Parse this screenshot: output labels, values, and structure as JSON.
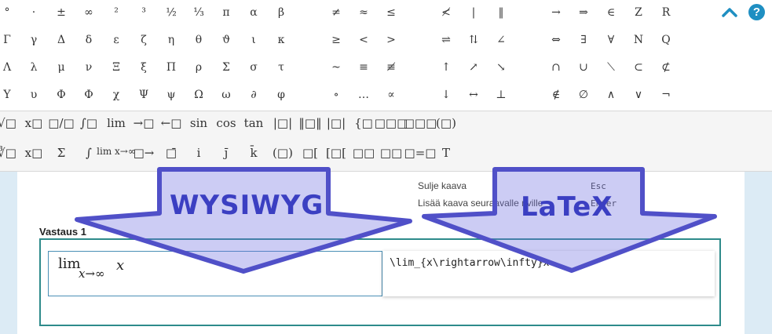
{
  "symbols": {
    "row1": [
      "°",
      "·",
      "±",
      "∞",
      "²",
      "³",
      "½",
      "⅓",
      "π",
      "α",
      "β",
      "≠",
      "≈",
      "≤",
      "≮",
      "|",
      "‖",
      "→",
      "⇒",
      "∈",
      "Z",
      "R"
    ],
    "row2": [
      "Γ",
      "γ",
      "Δ",
      "δ",
      "ε",
      "ζ",
      "η",
      "θ",
      "ϑ",
      "ι",
      "κ",
      "≥",
      "<",
      ">",
      "⇌",
      "⇅",
      "∠",
      "⇔",
      "∃",
      "∀",
      "N",
      "Q"
    ],
    "row3": [
      "Λ",
      "λ",
      "μ",
      "ν",
      "Ξ",
      "ξ",
      "Π",
      "ρ",
      "Σ",
      "σ",
      "τ",
      "~",
      "≡",
      "≢",
      "↑",
      "↗",
      "↘",
      "∩",
      "∪",
      "⟍",
      "⊂",
      "⊄"
    ],
    "row4": [
      "Υ",
      "υ",
      "Φ",
      "Φ",
      "χ",
      "Ψ",
      "ψ",
      "Ω",
      "ω",
      "∂",
      "φ",
      "∘",
      "…",
      "∝",
      "↓",
      "↔",
      "⊥",
      "∉",
      "∅",
      "∧",
      "∨",
      "¬"
    ]
  },
  "toolbar": {
    "row1": [
      "√□",
      "x□",
      "□/□",
      "∫□",
      "lim",
      "→□",
      "←□",
      "sin",
      "cos",
      "tan",
      "|□|",
      "‖□‖",
      "|□|",
      "{□",
      "□□□",
      "□□□",
      "(□)"
    ],
    "row2": [
      "∛□",
      "x□",
      "Σ",
      "∫",
      "lim x→∞",
      "□→",
      "□̄",
      "i",
      "j̄",
      "k̄",
      "(□)",
      "□[",
      "[□[",
      "□□",
      "□□",
      "□=□",
      "T"
    ]
  },
  "header": {
    "help_label": "?"
  },
  "shortcuts": {
    "close_formula": "Sulje kaava",
    "close_key": "Esc",
    "add_formula_next_row": "Lisää kaava seuraavalle riville",
    "add_key": "Enter"
  },
  "answer": {
    "label": "Vastaus 1",
    "wysiwyg_lim": "lim",
    "wysiwyg_sub": "x→∞",
    "wysiwyg_var": "x",
    "latex_source": "\\lim_{x\\rightarrow\\infty}x"
  },
  "annotations": {
    "left_label": "WYSIWYG",
    "right_label": "LaTeX",
    "arrow_color": "#6a6ad8",
    "arrow_stroke": "#4a4ab8"
  },
  "colors": {
    "accent": "#1f8fc2",
    "answer_border": "#2e8b8b",
    "field_border": "#4a8fb5"
  }
}
